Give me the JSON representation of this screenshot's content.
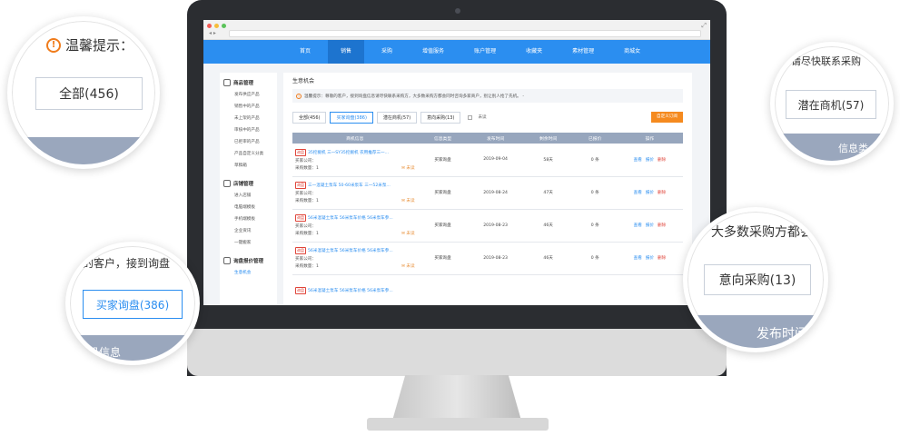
{
  "browser": {
    "nav_arrows": "◂ ▸",
    "resize_glyph": "⤢"
  },
  "topnav": [
    "首页",
    "销售",
    "采购",
    "增值服务",
    "账户管理",
    "收藏夹",
    "素材管理",
    "商城女"
  ],
  "sidebar": [
    {
      "title": "商品管理",
      "items": [
        "发布供应产品",
        "销售中的产品",
        "未上架的产品",
        "审核中的产品",
        "已拒审的产品",
        "产品自定义分类",
        "草稿箱"
      ]
    },
    {
      "title": "店铺管理",
      "items": [
        "进入店铺",
        "电脑端模板",
        "手机端模板",
        "企业资讯",
        "一键搬家"
      ]
    },
    {
      "title": "询盘报价管理",
      "items": [
        "生意机会"
      ]
    }
  ],
  "main": {
    "title": "生意机会",
    "notice": "温馨提示：尊敬的客户，接到询盘信息请尽快联系采购方，大多数采购方都会同时咨询多家商户，别让别人抢了先机。 -",
    "tabs": [
      "全部(456)",
      "买家询盘(386)",
      "潜在商机(57)",
      "意向采购(13)"
    ],
    "checkbox_label": "未读",
    "custom_button": "自定义订阅",
    "columns": [
      "商机信息",
      "信息类型",
      "发布时间",
      "剩余时间",
      "已报价",
      "操作"
    ],
    "rows": [
      {
        "tag": "询盘",
        "title": "35挖掘机 三一SY35挖掘机 农用推荐三一...",
        "company": "买家公司：",
        "qty": "采购数量：1",
        "status": "未读",
        "type": "买家询盘",
        "date": "2019-09-04",
        "remaining": "58天",
        "quoted": "0 条",
        "ops": [
          "查看",
          "报价",
          "删除"
        ]
      },
      {
        "tag": "询盘",
        "title": "三一混凝土泵车 50-60米泵车 三一52米泵...",
        "company": "买家公司：",
        "qty": "采购数量：1",
        "status": "未读",
        "type": "买家询盘",
        "date": "2019-08-24",
        "remaining": "47天",
        "quoted": "0 条",
        "ops": [
          "查看",
          "报价",
          "删除"
        ]
      },
      {
        "tag": "询盘",
        "title": "56米混凝土泵车 56米泵车价格 56米泵车参...",
        "company": "买家公司：",
        "qty": "采购数量：1",
        "status": "未读",
        "type": "买家询盘",
        "date": "2019-08-23",
        "remaining": "46天",
        "quoted": "0 条",
        "ops": [
          "查看",
          "报价",
          "删除"
        ]
      },
      {
        "tag": "询盘",
        "title": "56米混凝土泵车 56米泵车价格 56米泵车参...",
        "company": "买家公司：",
        "qty": "采购数量：1",
        "status": "未读",
        "type": "买家询盘",
        "date": "2019-08-23",
        "remaining": "46天",
        "quoted": "0 条",
        "ops": [
          "查看",
          "报价",
          "删除"
        ]
      },
      {
        "tag": "询盘",
        "title": "56米混凝土泵车 56米泵车价格 56米泵车参...",
        "company": "",
        "qty": "",
        "status": "",
        "type": "",
        "date": "",
        "remaining": "",
        "quoted": "",
        "ops": []
      }
    ]
  },
  "bubbles": {
    "top_left": {
      "notice": "温馨提示：",
      "tab": "全部(456)"
    },
    "top_right": {
      "notice": "请尽快联系采购",
      "tab": "潜在商机(57)",
      "band": "信息类"
    },
    "bottom_left": {
      "notice": "的客户，接到询盘",
      "tab": "买家询盘(386)",
      "band": "机信息"
    },
    "bottom_right": {
      "notice": "大多数采购方都会",
      "tab": "意向采购(13)",
      "band": "发布时间"
    }
  }
}
